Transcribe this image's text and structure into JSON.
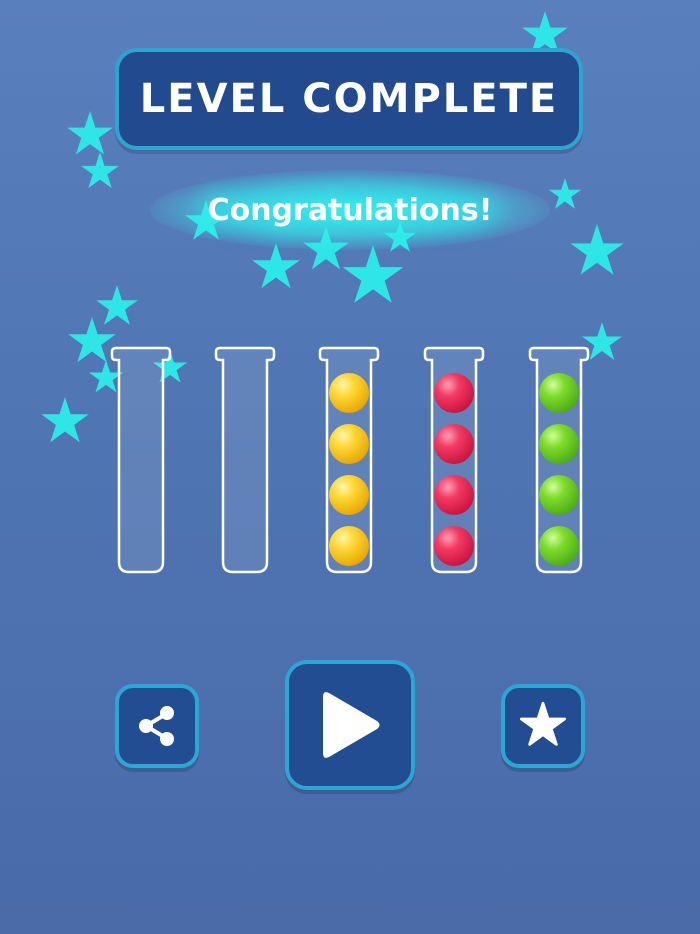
{
  "header": {
    "title": "LEVEL COMPLETE"
  },
  "message": {
    "congrats": "Congratulations!"
  },
  "colors": {
    "star": "#2ee6e6",
    "panel": "#224a8e",
    "panel_border": "#2ba6cf",
    "yellow": "#f2c01c",
    "red": "#e02850",
    "green": "#5ec21e"
  },
  "tubes": [
    {
      "balls": []
    },
    {
      "balls": []
    },
    {
      "balls": [
        "yellow",
        "yellow",
        "yellow",
        "yellow"
      ]
    },
    {
      "balls": [
        "red",
        "red",
        "red",
        "red"
      ]
    },
    {
      "balls": [
        "green",
        "green",
        "green",
        "green"
      ]
    }
  ],
  "buttons": {
    "share_icon": "share-icon",
    "play_icon": "play-icon",
    "rate_icon": "star-icon"
  }
}
